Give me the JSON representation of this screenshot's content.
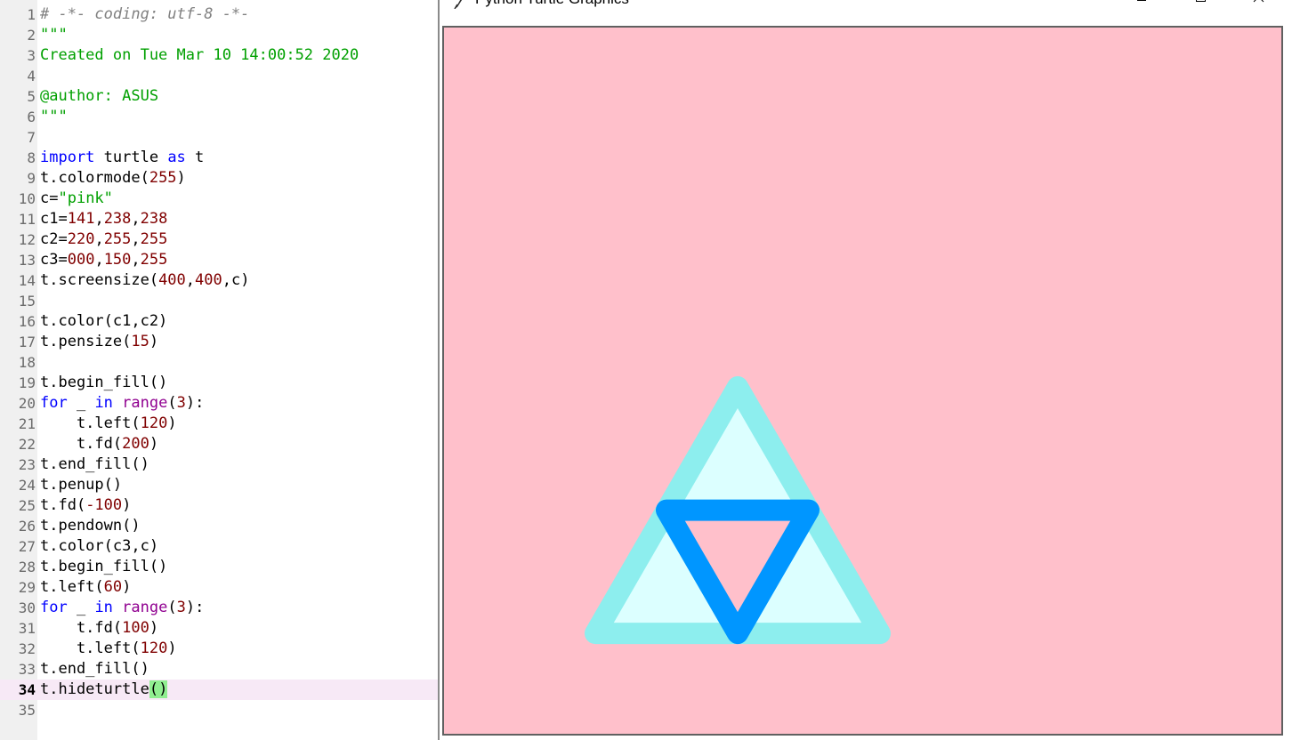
{
  "editor": {
    "current_line": 34,
    "lines": [
      {
        "n": "1",
        "tokens": [
          {
            "t": "# -*- coding: utf-8 -*-",
            "c": "comment"
          }
        ]
      },
      {
        "n": "2",
        "tokens": [
          {
            "t": "\"\"\"",
            "c": "string"
          }
        ]
      },
      {
        "n": "3",
        "tokens": [
          {
            "t": "Created on Tue Mar 10 14:00:52 2020",
            "c": "string"
          }
        ]
      },
      {
        "n": "4",
        "tokens": []
      },
      {
        "n": "5",
        "tokens": [
          {
            "t": "@author: ASUS",
            "c": "string"
          }
        ]
      },
      {
        "n": "6",
        "tokens": [
          {
            "t": "\"\"\"",
            "c": "string"
          }
        ]
      },
      {
        "n": "7",
        "tokens": []
      },
      {
        "n": "8",
        "tokens": [
          {
            "t": "import",
            "c": "keyword"
          },
          {
            "t": " turtle ",
            "c": "default"
          },
          {
            "t": "as",
            "c": "keyword"
          },
          {
            "t": " t",
            "c": "default"
          }
        ]
      },
      {
        "n": "9",
        "tokens": [
          {
            "t": "t.colormode(",
            "c": "default"
          },
          {
            "t": "255",
            "c": "number"
          },
          {
            "t": ")",
            "c": "default"
          }
        ]
      },
      {
        "n": "10",
        "tokens": [
          {
            "t": "c=",
            "c": "default"
          },
          {
            "t": "\"pink\"",
            "c": "string"
          }
        ]
      },
      {
        "n": "11",
        "tokens": [
          {
            "t": "c1=",
            "c": "default"
          },
          {
            "t": "141",
            "c": "number"
          },
          {
            "t": ",",
            "c": "default"
          },
          {
            "t": "238",
            "c": "number"
          },
          {
            "t": ",",
            "c": "default"
          },
          {
            "t": "238",
            "c": "number"
          }
        ]
      },
      {
        "n": "12",
        "tokens": [
          {
            "t": "c2=",
            "c": "default"
          },
          {
            "t": "220",
            "c": "number"
          },
          {
            "t": ",",
            "c": "default"
          },
          {
            "t": "255",
            "c": "number"
          },
          {
            "t": ",",
            "c": "default"
          },
          {
            "t": "255",
            "c": "number"
          }
        ]
      },
      {
        "n": "13",
        "tokens": [
          {
            "t": "c3=",
            "c": "default"
          },
          {
            "t": "000",
            "c": "number"
          },
          {
            "t": ",",
            "c": "default"
          },
          {
            "t": "150",
            "c": "number"
          },
          {
            "t": ",",
            "c": "default"
          },
          {
            "t": "255",
            "c": "number"
          }
        ]
      },
      {
        "n": "14",
        "tokens": [
          {
            "t": "t.screensize(",
            "c": "default"
          },
          {
            "t": "400",
            "c": "number"
          },
          {
            "t": ",",
            "c": "default"
          },
          {
            "t": "400",
            "c": "number"
          },
          {
            "t": ",c)",
            "c": "default"
          }
        ]
      },
      {
        "n": "15",
        "tokens": []
      },
      {
        "n": "16",
        "tokens": [
          {
            "t": "t.color(c1,c2)",
            "c": "default"
          }
        ]
      },
      {
        "n": "17",
        "tokens": [
          {
            "t": "t.pensize(",
            "c": "default"
          },
          {
            "t": "15",
            "c": "number"
          },
          {
            "t": ")",
            "c": "default"
          }
        ]
      },
      {
        "n": "18",
        "tokens": []
      },
      {
        "n": "19",
        "tokens": [
          {
            "t": "t.begin_fill()",
            "c": "default"
          }
        ]
      },
      {
        "n": "20",
        "tokens": [
          {
            "t": "for",
            "c": "keyword"
          },
          {
            "t": " _ ",
            "c": "default"
          },
          {
            "t": "in",
            "c": "keyword"
          },
          {
            "t": " ",
            "c": "default"
          },
          {
            "t": "range",
            "c": "builtin"
          },
          {
            "t": "(",
            "c": "default"
          },
          {
            "t": "3",
            "c": "number"
          },
          {
            "t": "):",
            "c": "default"
          }
        ]
      },
      {
        "n": "21",
        "tokens": [
          {
            "t": "    t.left(",
            "c": "default"
          },
          {
            "t": "120",
            "c": "number"
          },
          {
            "t": ")",
            "c": "default"
          }
        ]
      },
      {
        "n": "22",
        "tokens": [
          {
            "t": "    t.fd(",
            "c": "default"
          },
          {
            "t": "200",
            "c": "number"
          },
          {
            "t": ")",
            "c": "default"
          }
        ]
      },
      {
        "n": "23",
        "tokens": [
          {
            "t": "t.end_fill()",
            "c": "default"
          }
        ]
      },
      {
        "n": "24",
        "tokens": [
          {
            "t": "t.penup()",
            "c": "default"
          }
        ]
      },
      {
        "n": "25",
        "tokens": [
          {
            "t": "t.fd(",
            "c": "default"
          },
          {
            "t": "-100",
            "c": "number"
          },
          {
            "t": ")",
            "c": "default"
          }
        ]
      },
      {
        "n": "26",
        "tokens": [
          {
            "t": "t.pendown()",
            "c": "default"
          }
        ]
      },
      {
        "n": "27",
        "tokens": [
          {
            "t": "t.color(c3,c)",
            "c": "default"
          }
        ]
      },
      {
        "n": "28",
        "tokens": [
          {
            "t": "t.begin_fill()",
            "c": "default"
          }
        ]
      },
      {
        "n": "29",
        "tokens": [
          {
            "t": "t.left(",
            "c": "default"
          },
          {
            "t": "60",
            "c": "number"
          },
          {
            "t": ")",
            "c": "default"
          }
        ]
      },
      {
        "n": "30",
        "tokens": [
          {
            "t": "for",
            "c": "keyword"
          },
          {
            "t": " _ ",
            "c": "default"
          },
          {
            "t": "in",
            "c": "keyword"
          },
          {
            "t": " ",
            "c": "default"
          },
          {
            "t": "range",
            "c": "builtin"
          },
          {
            "t": "(",
            "c": "default"
          },
          {
            "t": "3",
            "c": "number"
          },
          {
            "t": "):",
            "c": "default"
          }
        ]
      },
      {
        "n": "31",
        "tokens": [
          {
            "t": "    t.fd(",
            "c": "default"
          },
          {
            "t": "100",
            "c": "number"
          },
          {
            "t": ")",
            "c": "default"
          }
        ]
      },
      {
        "n": "32",
        "tokens": [
          {
            "t": "    t.left(",
            "c": "default"
          },
          {
            "t": "120",
            "c": "number"
          },
          {
            "t": ")",
            "c": "default"
          }
        ]
      },
      {
        "n": "33",
        "tokens": [
          {
            "t": "t.end_fill()",
            "c": "default"
          }
        ]
      },
      {
        "n": "34",
        "tokens": [
          {
            "t": "t.hideturtle",
            "c": "default"
          },
          {
            "t": "()",
            "c": "brace"
          }
        ]
      },
      {
        "n": "35",
        "tokens": []
      }
    ]
  },
  "turtle_window": {
    "title": "Python Turtle Graphics",
    "icons": [
      "feather-icon",
      "minimize-icon",
      "maximize-icon",
      "close-icon"
    ],
    "canvas": {
      "background": "#ffc0cb",
      "outer_triangle": {
        "pen_color": "#8deeee",
        "fill_color": "#dcffff",
        "pen_size": 15,
        "side": 200
      },
      "inner_triangle": {
        "pen_color": "#0096ff",
        "fill_color": "#ffc0cb",
        "pen_size": 15,
        "side": 100
      }
    }
  }
}
